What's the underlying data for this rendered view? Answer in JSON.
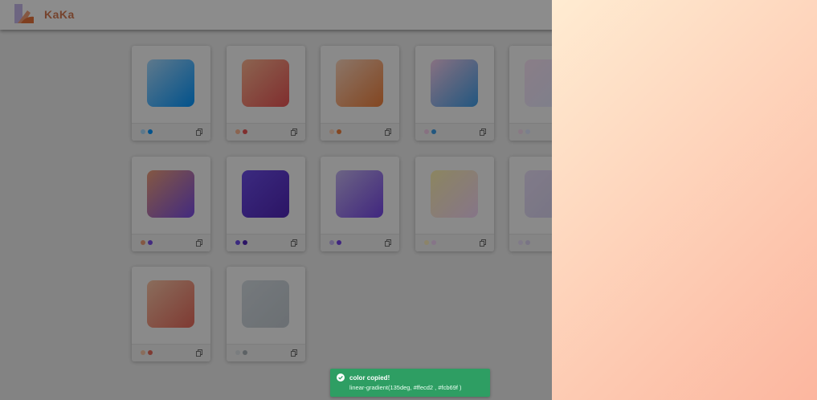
{
  "app": {
    "logo_text": "KaKa",
    "logo_colors": [
      "#f3a07b",
      "#e8743b",
      "#c2b4f0"
    ]
  },
  "cards": [
    {
      "gradient": "linear-gradient(135deg, #abdcff, #0396ff)",
      "colors": [
        "#abdcff",
        "#0396ff"
      ]
    },
    {
      "gradient": "linear-gradient(135deg, #feb692, #ea5455)",
      "colors": [
        "#feb692",
        "#ea5455"
      ]
    },
    {
      "gradient": "linear-gradient(135deg, #fdd6bd, #f0803c)",
      "colors": [
        "#fdd6bd",
        "#f0803c"
      ]
    },
    {
      "gradient": "linear-gradient(135deg, #f6ceec, #3f9ee8)",
      "colors": [
        "#f6ceec",
        "#3f9ee8"
      ]
    },
    {
      "gradient": "linear-gradient(135deg, #fbe4f6, #e3e9ff)",
      "colors": [
        "#f9dcf1",
        "#e0e7ff"
      ]
    },
    {
      "gradient": "linear-gradient(135deg, #f0a07a, #7a4de8)",
      "colors": [
        "#f0a07a",
        "#7a4de8"
      ]
    },
    {
      "gradient": "linear-gradient(135deg, #6c4de8, #5026b8)",
      "colors": [
        "#6c4de8",
        "#5026b8"
      ]
    },
    {
      "gradient": "linear-gradient(135deg, #c5b6f0, #7646e8)",
      "colors": [
        "#c5b6f0",
        "#7646e8"
      ]
    },
    {
      "gradient": "linear-gradient(135deg, #fff3b0, #f4d6f8)",
      "colors": [
        "#fff0c0",
        "#f4d6f8"
      ]
    },
    {
      "gradient": "linear-gradient(135deg, #eadff9, #d8d4f0)",
      "colors": [
        "#eadff9",
        "#dcd4f2"
      ]
    },
    {
      "gradient": "linear-gradient(135deg, #fbc7a8, #e86a5c)",
      "colors": [
        "#fbc7a8",
        "#e86a5c"
      ]
    },
    {
      "gradient": "linear-gradient(135deg, #d5dde3, #c3cbd2)",
      "colors": [
        "#dfe3e7",
        "#aab2b8"
      ]
    }
  ],
  "preview": {
    "gradient": "linear-gradient(135deg, #ffecd2, #fcb69f)"
  },
  "toast": {
    "title": "color copied!",
    "message": "linear-gradient(135deg, #ffecd2 , #fcb69f )",
    "bg_color": "#2e9e63"
  }
}
